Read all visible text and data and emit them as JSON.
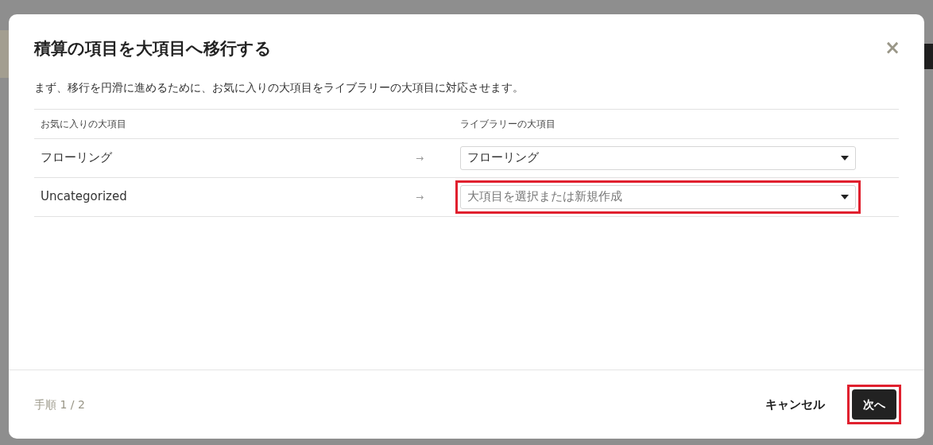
{
  "dialog": {
    "title": "積算の項目を大項目へ移行する",
    "close": "×",
    "description": "まず、移行を円滑に進めるために、お気に入りの大項目をライブラリーの大項目に対応させます。",
    "columns": [
      "お気に入りの大項目",
      "ライブラリーの大項目"
    ],
    "rows": [
      {
        "source": "フローリング",
        "arrow": "→",
        "select": {
          "value": "フローリング",
          "highlighted": false
        }
      },
      {
        "source": "Uncategorized",
        "arrow": "→",
        "select": {
          "placeholder": "大項目を選択または新規作成",
          "highlighted": true
        }
      }
    ],
    "step": "手順 1 / 2",
    "buttons": [
      {
        "kind": "secondary",
        "label": "キャンセル",
        "highlighted": false
      },
      {
        "kind": "primary",
        "label": "次へ",
        "highlighted": true
      }
    ]
  }
}
